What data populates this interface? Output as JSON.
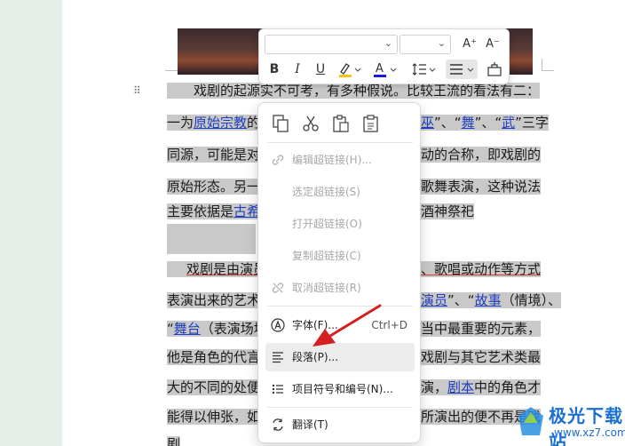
{
  "document": {
    "para1_lines": [
      [
        "戏剧的起源实不可考，有多种假说。比较王流的看法有二："
      ],
      [
        "一为",
        "原始宗教",
        "的",
        "巫",
        "”、“",
        "舞",
        "”、“",
        "武",
        "”三字"
      ],
      [
        "同源，可能是对",
        "动的合称，即戏剧的"
      ],
      [
        "原始形态。另一",
        "歌舞表演，这种说法"
      ],
      [
        "主要依据是",
        "古希",
        "酒神祭祀"
      ]
    ],
    "para2_lines": [
      [
        "戏剧是由演员",
        "、歌唱或动作等方式"
      ],
      [
        "表演出来的艺术",
        "演员",
        "”、“",
        "故事",
        "（情境）、"
      ],
      [
        "“",
        "舞台",
        "（表演场地",
        "当中最重要的元素，"
      ],
      [
        "他是角色的代言",
        "戏剧与其它艺术类最"
      ],
      [
        "大的不同的处便",
        "演，",
        "剧本",
        "中的角色才"
      ],
      [
        "能得以伸张，如",
        "所演出的便不再是戏"
      ],
      [
        "剧"
      ]
    ]
  },
  "mini_toolbar": {
    "font_value": "",
    "size_value": "",
    "icons": [
      "increase-font-icon",
      "decrease-font-icon",
      "bold-icon",
      "italic-icon",
      "underline-icon",
      "highlight-icon",
      "font-color-icon",
      "line-spacing-icon",
      "align-icon",
      "clear-format-icon"
    ],
    "bold": "B",
    "italic": "I",
    "underline": "U",
    "font_color_glyph": "A",
    "grow": "A⁺",
    "shrink": "A⁻",
    "highlight_color": "#f5c518",
    "font_color": "#1a1adf"
  },
  "context_menu": {
    "top_icons": [
      "copy-icon",
      "cut-icon",
      "paste-icon",
      "paste-special-icon"
    ],
    "items": [
      {
        "label": "编辑超链接(H)...",
        "disabled": true,
        "icon": "edit-link-icon"
      },
      {
        "label": "选定超链接(S)",
        "disabled": true,
        "icon": ""
      },
      {
        "label": "打开超链接(O)",
        "disabled": true,
        "icon": ""
      },
      {
        "label": "复制超链接(C)",
        "disabled": true,
        "icon": ""
      },
      {
        "label": "取消超链接(R)",
        "disabled": true,
        "icon": "unlink-icon"
      },
      {
        "label": "字体(F)...",
        "shortcut": "Ctrl+D",
        "disabled": false,
        "icon": "font-icon"
      },
      {
        "label": "段落(P)...",
        "disabled": false,
        "icon": "paragraph-icon"
      },
      {
        "label": "项目符号和编号(N)...",
        "disabled": false,
        "icon": "bullets-icon"
      },
      {
        "label": "翻译(T)",
        "disabled": false,
        "icon": "translate-icon"
      }
    ]
  },
  "watermark": {
    "title": "极光下载站",
    "url": "www.xz7.com"
  },
  "colors": {
    "selection": "#c9c9c9",
    "link": "#1f3fbf",
    "arrow": "#d42020"
  }
}
